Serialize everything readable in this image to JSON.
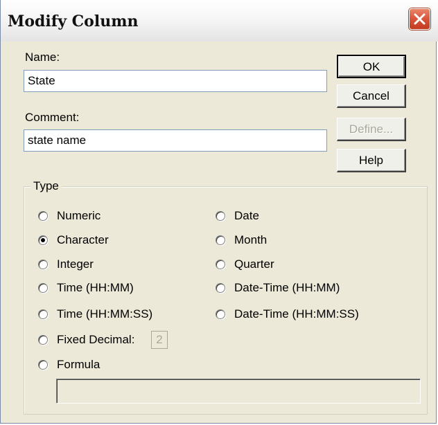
{
  "window": {
    "title": "Modify Column"
  },
  "name": {
    "label": "Name:",
    "value": "State"
  },
  "comment": {
    "label": "Comment:",
    "value": "state name"
  },
  "buttons": {
    "ok": "OK",
    "cancel": "Cancel",
    "define": "Define...",
    "help": "Help"
  },
  "type_group": {
    "label": "Type",
    "selected": "Character",
    "left": [
      "Numeric",
      "Character",
      "Integer",
      "Time (HH:MM)",
      "Time (HH:MM:SS)",
      "Fixed Decimal:",
      "Formula"
    ],
    "right": [
      "Date",
      "Month",
      "Quarter",
      "Date-Time (HH:MM)",
      "Date-Time (HH:MM:SS)"
    ],
    "fixed_decimal_value": "2",
    "formula_value": ""
  },
  "icons": {
    "close": "close-icon"
  },
  "colors": {
    "dialog_bg": "#ece9d8",
    "close_button": "#d8543a",
    "field_border": "#7f9db9"
  }
}
